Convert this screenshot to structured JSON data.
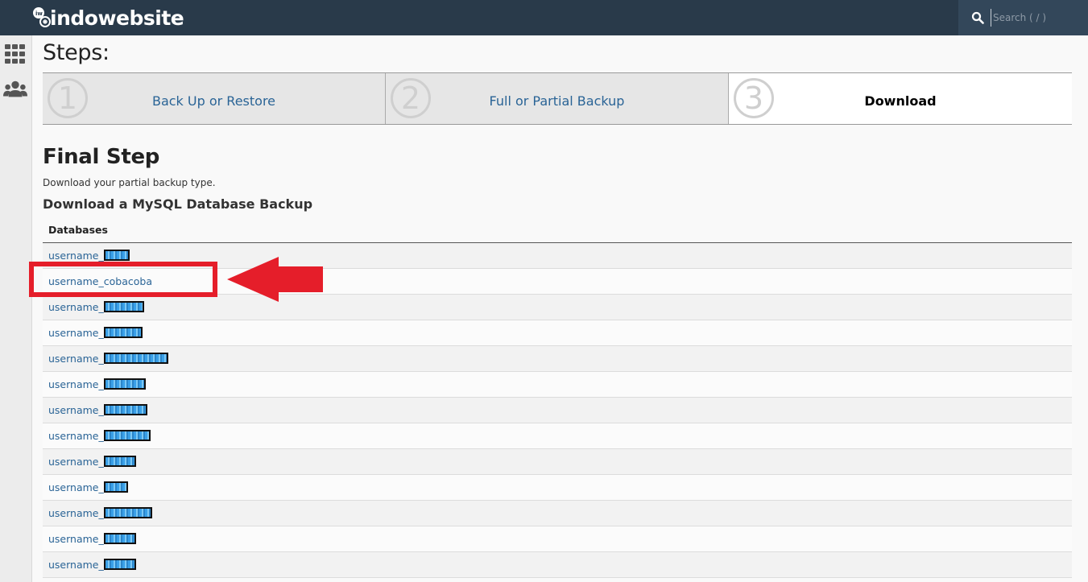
{
  "brand": {
    "logo_text": "indowebsite"
  },
  "search": {
    "placeholder": "Search ( / )"
  },
  "sidebar": {
    "items": [
      {
        "icon": "grid-icon"
      },
      {
        "icon": "users-icon"
      }
    ]
  },
  "steps": {
    "title": "Steps:",
    "items": [
      {
        "number": "1",
        "label": "Back Up or Restore",
        "active": false
      },
      {
        "number": "2",
        "label": "Full or Partial Backup",
        "active": false
      },
      {
        "number": "3",
        "label": "Download",
        "active": true
      }
    ]
  },
  "final": {
    "title": "Final Step",
    "description": "Download your partial backup type.",
    "section_title": "Download a MySQL Database Backup"
  },
  "databases": {
    "header": "Databases",
    "rows": [
      {
        "name": "username_",
        "redacted": true
      },
      {
        "name": "username_cobacoba",
        "redacted": false
      },
      {
        "name": "username_",
        "redacted": true
      },
      {
        "name": "username_",
        "redacted": true
      },
      {
        "name": "username_",
        "redacted": true
      },
      {
        "name": "username_",
        "redacted": true
      },
      {
        "name": "username_",
        "redacted": true
      },
      {
        "name": "username_",
        "redacted": true
      },
      {
        "name": "username_",
        "redacted": true
      },
      {
        "name": "username_",
        "redacted": true
      },
      {
        "name": "username_",
        "redacted": true
      },
      {
        "name": "username_",
        "redacted": true
      },
      {
        "name": "username_",
        "redacted": true
      }
    ]
  },
  "colors": {
    "topbar": "#293a4a",
    "link": "#2a6496",
    "annotation": "#e51e2a"
  }
}
